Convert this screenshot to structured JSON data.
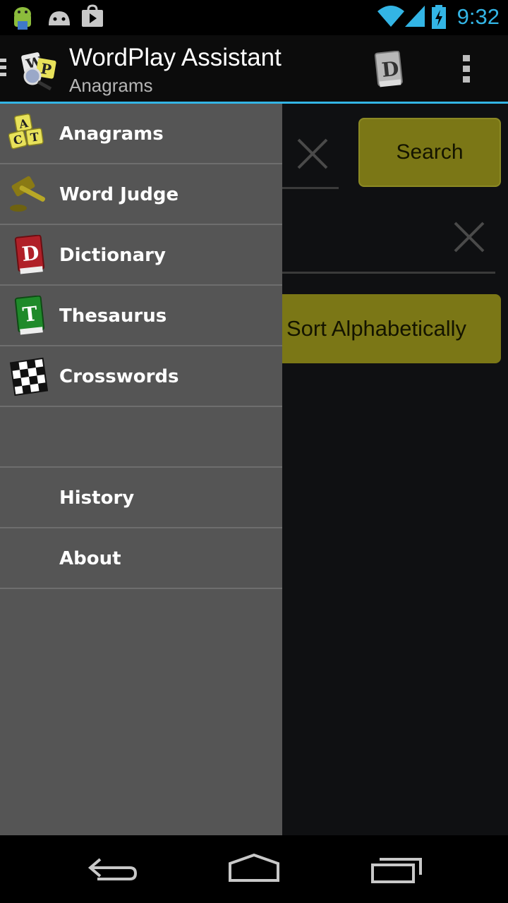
{
  "status_bar": {
    "time": "9:32",
    "icons": [
      "android-debug-icon",
      "android-notification-icon",
      "play-store-icon",
      "wifi-icon",
      "signal-icon",
      "battery-charging-icon"
    ],
    "accent_color": "#33b5e5"
  },
  "action_bar": {
    "title": "WordPlay Assistant",
    "subtitle": "Anagrams",
    "icons": [
      "drawer-toggle-icon",
      "app-logo-icon",
      "dictionary-action-icon",
      "overflow-menu-icon"
    ]
  },
  "main": {
    "search_button": "Search",
    "sort_button": "Sort Alphabetically",
    "button_color": "#7b7716"
  },
  "drawer": {
    "items": [
      {
        "label": "Anagrams",
        "icon": "anagram-tiles-icon"
      },
      {
        "label": "Word Judge",
        "icon": "gavel-icon"
      },
      {
        "label": "Dictionary",
        "icon": "dictionary-book-icon"
      },
      {
        "label": "Thesaurus",
        "icon": "thesaurus-book-icon"
      },
      {
        "label": "Crosswords",
        "icon": "crossword-grid-icon"
      },
      {
        "label": "",
        "icon": ""
      },
      {
        "label": "History",
        "icon": ""
      },
      {
        "label": "About",
        "icon": ""
      }
    ],
    "background_color": "#555555"
  },
  "nav_bar": {
    "icons": [
      "back-icon",
      "home-icon",
      "recent-apps-icon"
    ]
  }
}
